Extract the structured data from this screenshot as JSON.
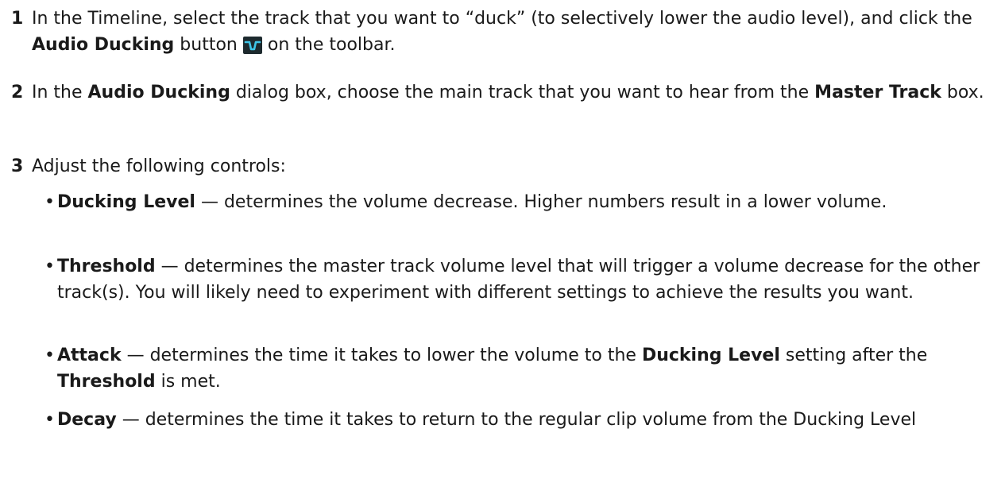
{
  "steps": [
    {
      "num": "1",
      "t1": "In the Timeline, select the track that you want to “duck” (to selectively lower the audio level), and click the ",
      "b1": "Audio Ducking",
      "t2": " button ",
      "icon": "audio-ducking-icon",
      "t3": " on the toolbar."
    },
    {
      "num": "2",
      "t1": "In the ",
      "b1": "Audio Ducking",
      "t2": " dialog box, choose the main track that you want to hear from the ",
      "b2": "Master Track",
      "t3": " box."
    },
    {
      "num": "3",
      "t1": "Adjust the following controls:"
    }
  ],
  "bullets": [
    {
      "dot": "•",
      "b1": "Ducking Level",
      "t1": " — determines the volume decrease. Higher numbers result in a lower volume."
    },
    {
      "dot": "•",
      "b1": "Threshold",
      "t1": " — determines the master track volume level that will trigger a volume decrease for the other track(s). You will likely need to experiment with different settings to achieve the results you want."
    },
    {
      "dot": "•",
      "b1": "Attack",
      "t1": " — determines the time it takes to lower the volume to the ",
      "b2": "Ducking Level",
      "t2": " setting after the ",
      "b3": "Threshold",
      "t3": " is met."
    },
    {
      "dot": "•",
      "b1": "Decay",
      "t1": " — determines the time it takes to return to the regular clip volume from the Ducking Level"
    }
  ],
  "colors": {
    "icon_bg": "#1d2a2e",
    "icon_line": "#3ec6e8"
  }
}
